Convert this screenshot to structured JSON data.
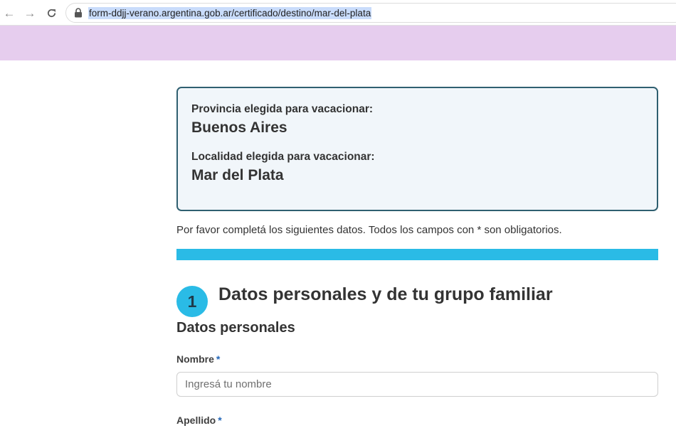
{
  "browser": {
    "url": "form-ddjj-verano.argentina.gob.ar/certificado/destino/mar-del-plata",
    "back_icon": "arrow-left-icon",
    "forward_icon": "arrow-right-icon",
    "reload_icon": "reload-icon",
    "lock_icon": "lock-icon"
  },
  "colors": {
    "header_band": "#e6cdee",
    "accent": "#2abbe6",
    "card_border": "#2f5f70",
    "card_bg": "#f1f6fa",
    "required_mark": "#2467b8"
  },
  "destination": {
    "province_label": "Provincia elegida para vacacionar:",
    "province_value": "Buenos Aires",
    "locality_label": "Localidad elegida para vacacionar:",
    "locality_value": "Mar del Plata"
  },
  "instructions": "Por favor completá los siguientes datos. Todos los campos con * son obligatorios.",
  "step": {
    "number": "1",
    "title": "Datos personales y de tu grupo familiar",
    "subsection": "Datos personales"
  },
  "form": {
    "required_mark": "*",
    "nombre": {
      "label": "Nombre",
      "placeholder": "Ingresá tu nombre",
      "value": ""
    },
    "apellido": {
      "label": "Apellido"
    }
  }
}
